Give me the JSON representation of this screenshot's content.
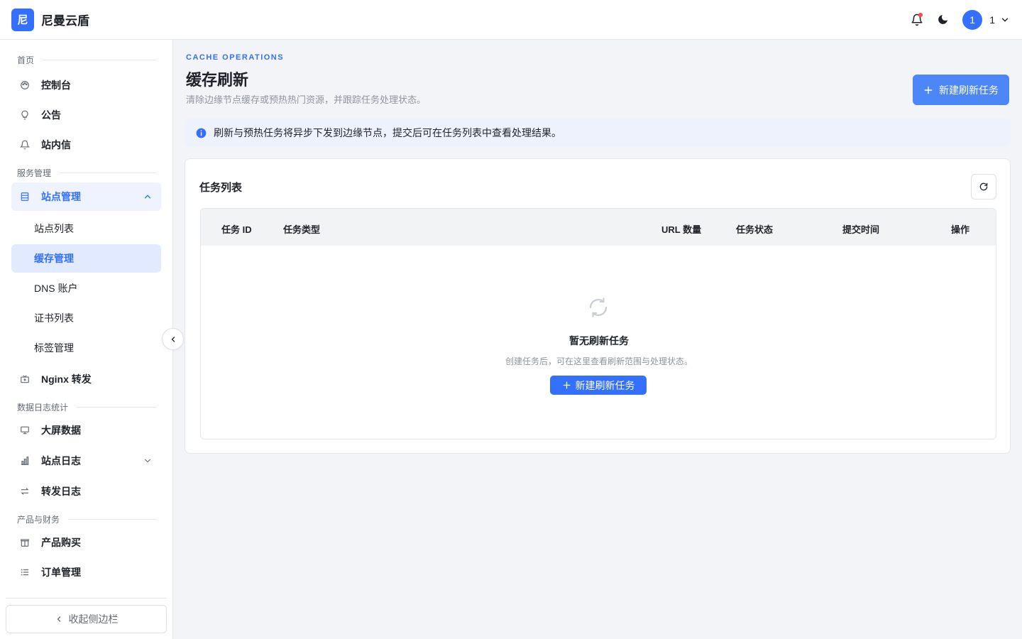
{
  "header": {
    "logo_char": "尼",
    "app_title": "尼曼云盾",
    "avatar_initial": "1",
    "user_name": "1",
    "icons": [
      "bell-icon",
      "moon-icon",
      "chevron-down-icon"
    ],
    "notification_dot_color": "#f54a45"
  },
  "sidebar": {
    "groups": {
      "home": "首页",
      "service": "服务管理",
      "logs": "数据日志统计",
      "finance": "产品与财务"
    },
    "items": {
      "console": "控制台",
      "announcements": "公告",
      "messages": "站内信",
      "site_management": "站点管理",
      "nginx": "Nginx 转发",
      "big_screen": "大屏数据",
      "site_logs": "站点日志",
      "forward_logs": "转发日志",
      "purchase": "产品购买",
      "orders": "订单管理"
    },
    "sub_items": {
      "site_list": "站点列表",
      "cache": "缓存管理",
      "dns": "DNS 账户",
      "certs": "证书列表",
      "tags": "标签管理"
    },
    "collapse_label": "收起侧边栏"
  },
  "main": {
    "eyebrow": "CACHE OPERATIONS",
    "title": "缓存刷新",
    "description": "清除边缘节点缓存或预热热门资源，并跟踪任务处理状态。",
    "new_task_label": "新建刷新任务",
    "info_text": "刷新与预热任务将异步下发到边缘节点，提交后可在任务列表中查看处理结果。",
    "card_title": "任务列表",
    "columns": [
      "任务 ID",
      "任务类型",
      "URL 数量",
      "任务状态",
      "提交时间",
      "操作"
    ],
    "empty": {
      "title": "暂无刷新任务",
      "description": "创建任务后，可在这里查看刷新范围与处理状态。",
      "button_label": "新建刷新任务"
    }
  },
  "colors": {
    "accent": "#3370ff",
    "primary_button": "#4c86f7",
    "info_bg": "#edf2fd"
  }
}
